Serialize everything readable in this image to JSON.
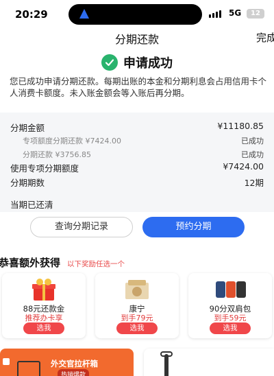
{
  "status_bar": {
    "time": "20:29",
    "network": "5G",
    "battery": "12"
  },
  "header": {
    "title": "分期还款",
    "done": "完成"
  },
  "success": {
    "title": "申请成功",
    "description": "您已成功申请分期还款。每期出账的本金和分期利息会占用信用卡个人消费卡额度。未入账金额会等入账后再分期。"
  },
  "details": {
    "rows": [
      {
        "label": "分期金额",
        "value": "¥11180.85"
      },
      {
        "label": "专项额度分期还款 ¥7424.00",
        "value": "已成功"
      },
      {
        "label": "分期还款 ¥3756.85",
        "value": "已成功"
      },
      {
        "label": "使用专项分期额度",
        "value": "¥7424.00"
      },
      {
        "label": "分期期数",
        "value": "12期"
      }
    ],
    "cleared": "当期已还清"
  },
  "buttons": {
    "query": "查询分期记录",
    "book": "预约分期"
  },
  "bonus": {
    "title": "恭喜额外获得",
    "subtitle": "以下奖励任选一个",
    "cards": [
      {
        "name": "88元还款金",
        "price": "推荐办卡享",
        "button": "选我"
      },
      {
        "name": "康宁",
        "price": "到手79元",
        "button": "选我"
      },
      {
        "name": "90分双肩包",
        "price": "到手59元",
        "button": "选我"
      }
    ]
  },
  "promo": {
    "title": "外交官拉杆箱",
    "badge": "热销爆款"
  },
  "colors": {
    "accent": "#2d6cf0",
    "success": "#29b36d",
    "red": "#f0474a",
    "promo": "#f26a2e"
  }
}
